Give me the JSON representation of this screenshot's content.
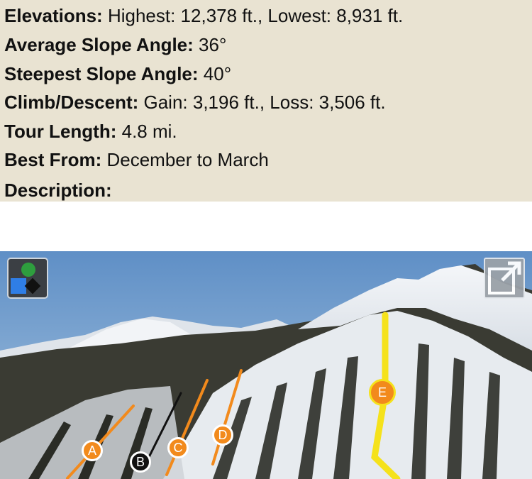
{
  "details": {
    "elevations": {
      "label": "Elevations:",
      "value": "Highest: 12,378 ft., Lowest: 8,931 ft."
    },
    "average_slope": {
      "label": "Average Slope Angle:",
      "value": "36°"
    },
    "steepest_slope": {
      "label": "Steepest Slope Angle:",
      "value": "40°"
    },
    "climb_descent": {
      "label": "Climb/Descent:",
      "value": "Gain: 3,196 ft., Loss: 3,506 ft."
    },
    "tour_length": {
      "label": "Tour Length:",
      "value": "4.8 mi."
    },
    "best_from": {
      "label": "Best From:",
      "value": "December to March"
    },
    "description": {
      "label": "Description:"
    }
  },
  "photo": {
    "level_icon": "difficulty-level-icon",
    "expand_icon": "expand-icon",
    "route_markers": [
      {
        "label": "A",
        "style": "orange"
      },
      {
        "label": "B",
        "style": "black"
      },
      {
        "label": "C",
        "style": "orange"
      },
      {
        "label": "D",
        "style": "orange"
      },
      {
        "label": "E",
        "style": "orange"
      }
    ]
  },
  "colors": {
    "panel_bg": "#e9e3d2",
    "route_orange": "#f28a1c",
    "route_yellow": "#f5e21b",
    "route_black": "#111111"
  }
}
